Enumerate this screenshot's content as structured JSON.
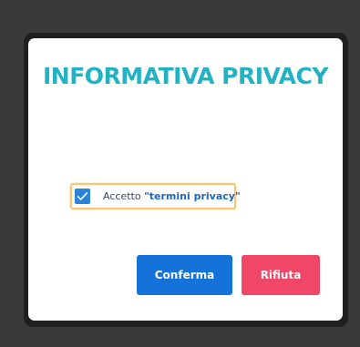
{
  "dialog": {
    "title": "INFORMATIVA PRIVACY",
    "consent": {
      "checked": true,
      "label_prefix": "Accetto",
      "link_text": "\"termini privacy\""
    },
    "buttons": {
      "confirm_label": "Conferma",
      "reject_label": "Rifiuta"
    },
    "colors": {
      "title": "#23b2c4",
      "confirm": "#1572d8",
      "reject": "#f04766",
      "checkbox": "#2b82d9",
      "focus_outline": "#f7c776"
    }
  }
}
